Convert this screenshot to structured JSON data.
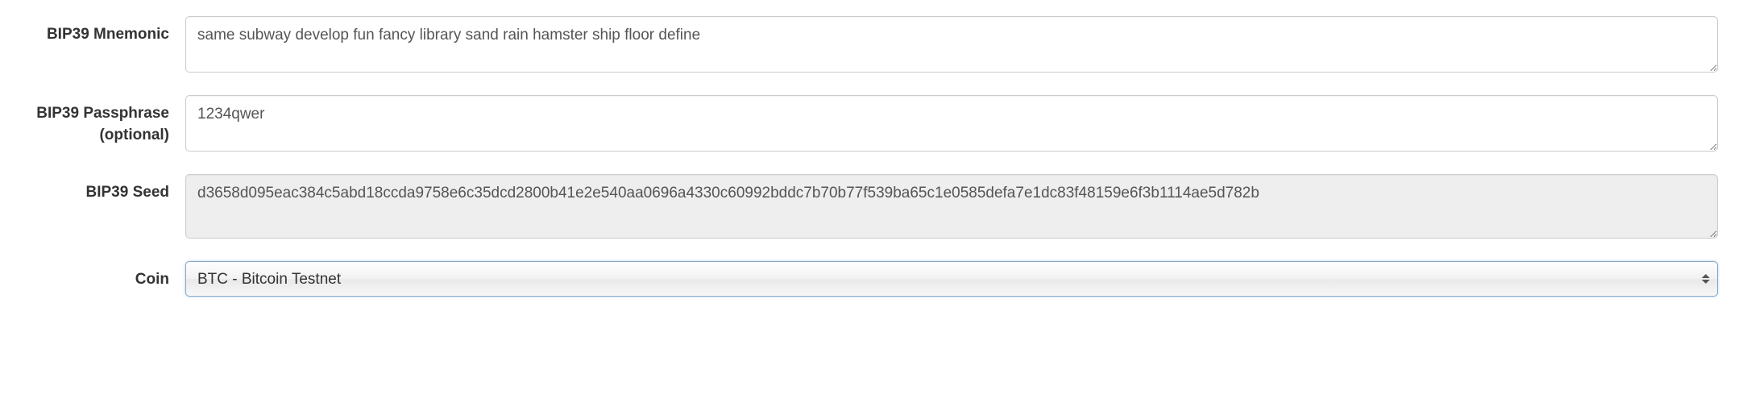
{
  "labels": {
    "mnemonic": "BIP39 Mnemonic",
    "passphrase": "BIP39 Passphrase (optional)",
    "seed": "BIP39 Seed",
    "coin": "Coin"
  },
  "values": {
    "mnemonic": "same subway develop fun fancy library sand rain hamster ship floor define",
    "passphrase": "1234qwer",
    "seed": "d3658d095eac384c5abd18ccda9758e6c35dcd2800b41e2e540aa0696a4330c60992bddc7b70b77f539ba65c1e0585defa7e1dc83f48159e6f3b1114ae5d782b",
    "coin_selected": "BTC - Bitcoin Testnet"
  }
}
